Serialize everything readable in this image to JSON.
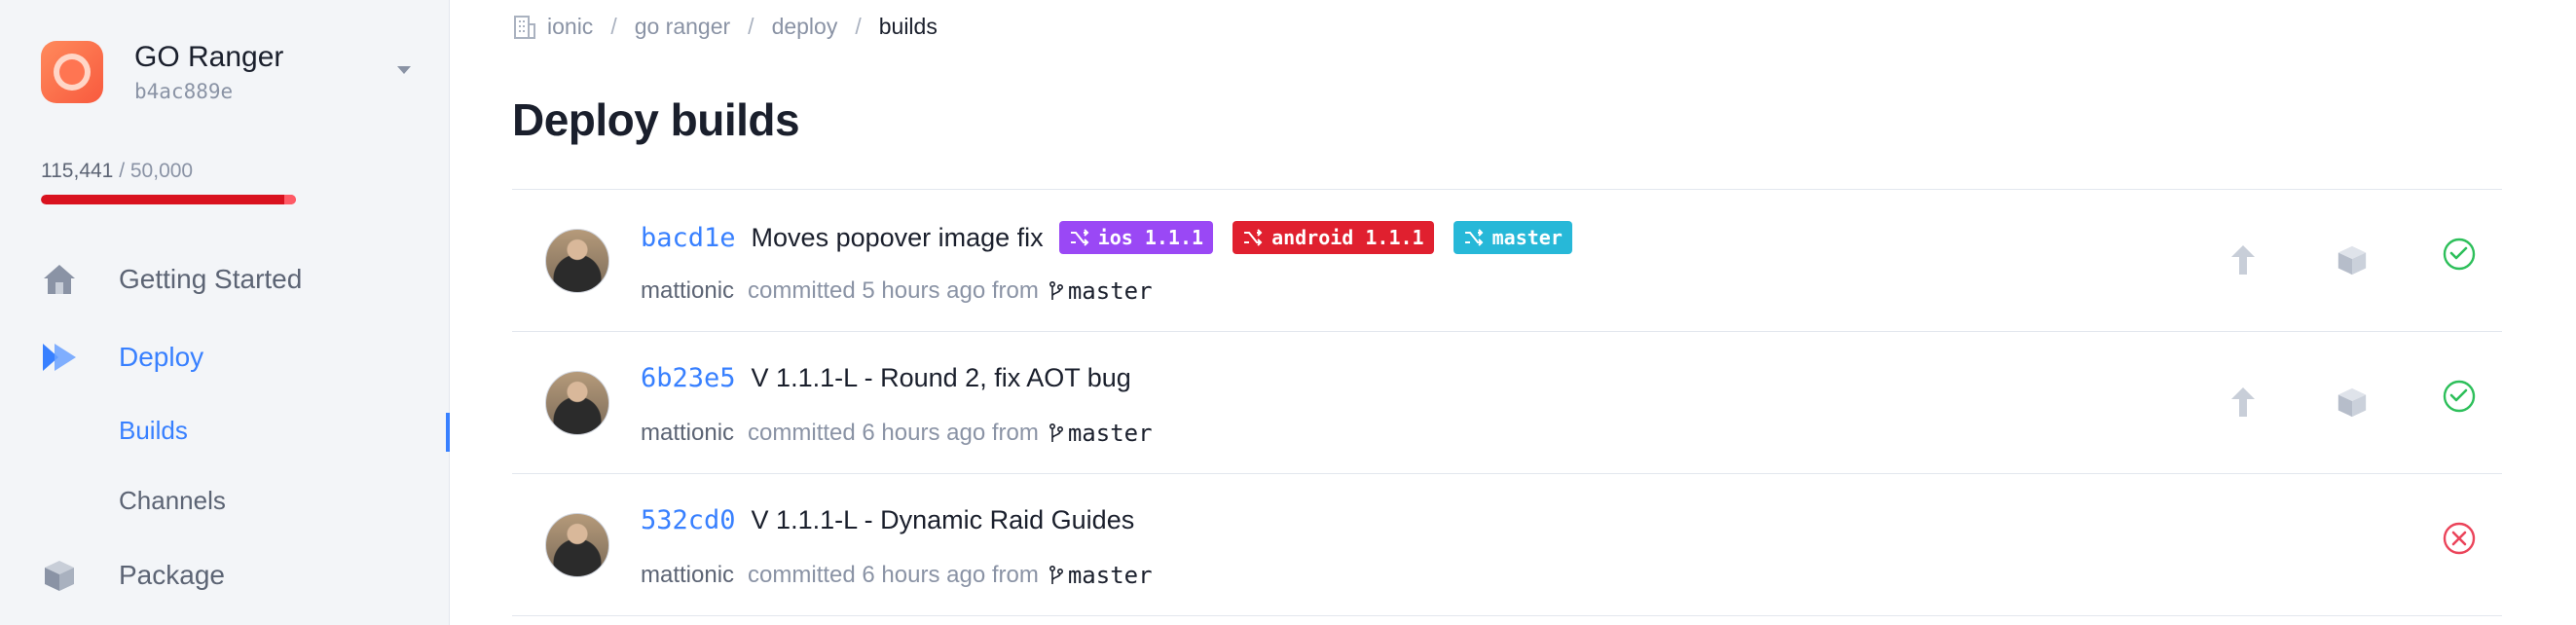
{
  "app": {
    "name": "GO Ranger",
    "id": "b4ac889e"
  },
  "usage": {
    "used": "115,441",
    "separator": " / ",
    "limit": "50,000",
    "fraction": 1.0
  },
  "nav": {
    "getting_started": "Getting Started",
    "deploy": "Deploy",
    "builds": "Builds",
    "channels": "Channels",
    "package": "Package"
  },
  "breadcrumb": [
    "ionic",
    "go ranger",
    "deploy",
    "builds"
  ],
  "breadcrumb_sep": "/",
  "page_title": "Deploy builds",
  "colors": {
    "accent": "#3880ff",
    "ios_tag": "#9a48f5",
    "android_tag": "#e0202f",
    "master_tag": "#27b8d8",
    "success": "#2dbf5a",
    "failure": "#eb445a"
  },
  "builds": [
    {
      "sha": "bacd1e",
      "message": "Moves popover image fix",
      "tags": [
        {
          "label": "ios 1.1.1",
          "color": "#9a48f5"
        },
        {
          "label": "android 1.1.1",
          "color": "#e0202f"
        },
        {
          "label": "master",
          "color": "#27b8d8"
        }
      ],
      "author": "mattionic",
      "time": "committed 5 hours ago from",
      "branch": "master",
      "status": "success"
    },
    {
      "sha": "6b23e5",
      "message": "V 1.1.1-L - Round 2, fix AOT bug",
      "tags": [],
      "author": "mattionic",
      "time": "committed 6 hours ago from",
      "branch": "master",
      "status": "success"
    },
    {
      "sha": "532cd0",
      "message": "V 1.1.1-L - Dynamic Raid Guides",
      "tags": [],
      "author": "mattionic",
      "time": "committed 6 hours ago from",
      "branch": "master",
      "status": "failed"
    }
  ]
}
